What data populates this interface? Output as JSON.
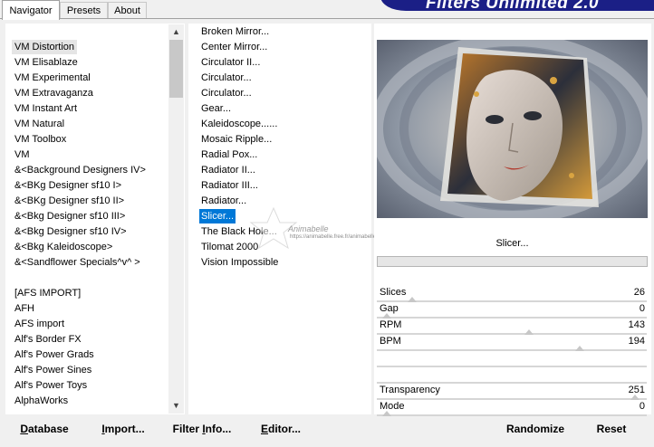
{
  "app": {
    "banner_title": "Filters Unlimited 2.0"
  },
  "tabs": [
    {
      "label": "Navigator",
      "active": true
    },
    {
      "label": "Presets",
      "active": false
    },
    {
      "label": "About",
      "active": false
    }
  ],
  "categories": [
    {
      "label": "VM Distortion",
      "selected": true
    },
    {
      "label": "VM Elisablaze"
    },
    {
      "label": "VM Experimental"
    },
    {
      "label": "VM Extravaganza"
    },
    {
      "label": "VM Instant Art"
    },
    {
      "label": "VM Natural"
    },
    {
      "label": "VM Toolbox"
    },
    {
      "label": "VM"
    },
    {
      "label": "&<Background Designers IV>"
    },
    {
      "label": "&<BKg Designer sf10 I>"
    },
    {
      "label": "&<BKg Designer sf10 II>"
    },
    {
      "label": "&<Bkg Designer sf10 III>"
    },
    {
      "label": "&<Bkg Designer sf10 IV>"
    },
    {
      "label": "&<Bkg Kaleidoscope>"
    },
    {
      "label": "&<Sandflower Specials^v^ >"
    },
    {
      "label": ""
    },
    {
      "label": "[AFS IMPORT]"
    },
    {
      "label": "AFH"
    },
    {
      "label": "AFS import"
    },
    {
      "label": "Alf's Border FX"
    },
    {
      "label": "Alf's Power Grads"
    },
    {
      "label": "Alf's Power Sines"
    },
    {
      "label": "Alf's Power Toys"
    },
    {
      "label": "AlphaWorks"
    }
  ],
  "scroll": {
    "up_icon": "▲",
    "down_icon": "▼"
  },
  "filters": [
    {
      "label": "Broken Mirror..."
    },
    {
      "label": "Center Mirror..."
    },
    {
      "label": "Circulator II..."
    },
    {
      "label": "Circulator..."
    },
    {
      "label": "Circulator..."
    },
    {
      "label": "Gear..."
    },
    {
      "label": "Kaleidoscope......"
    },
    {
      "label": "Mosaic Ripple..."
    },
    {
      "label": "Radial Pox..."
    },
    {
      "label": "Radiator II..."
    },
    {
      "label": "Radiator III..."
    },
    {
      "label": "Radiator..."
    },
    {
      "label": "Slicer...",
      "selected": true
    },
    {
      "label": "The Black Hole..."
    },
    {
      "label": "Tilomat 2000"
    },
    {
      "label": "Vision Impossible"
    }
  ],
  "preview": {
    "filter_name": "Slicer..."
  },
  "params": [
    {
      "label": "Slices",
      "value": "26",
      "level": 0.1
    },
    {
      "label": "Gap",
      "value": "0",
      "level": 0.0
    },
    {
      "label": "RPM",
      "value": "143",
      "level": 0.56
    },
    {
      "label": "BPM",
      "value": "194",
      "level": 0.76
    },
    {
      "label": "",
      "value": ""
    },
    {
      "label": "",
      "value": ""
    },
    {
      "label": "Transparency",
      "value": "251",
      "level": 0.98
    },
    {
      "label": "Mode",
      "value": "0",
      "level": 0.0
    }
  ],
  "buttons": {
    "database": {
      "u": "D",
      "rest": "atabase"
    },
    "import": {
      "u": "I",
      "rest": "mport..."
    },
    "filter_info": {
      "pre": "Filter ",
      "u": "I",
      "rest": "nfo..."
    },
    "editor": {
      "u": "E",
      "rest": "ditor..."
    },
    "randomize": "Randomize",
    "reset": "Reset"
  },
  "watermark": {
    "line1": "Animabelle",
    "line2": "https://animabelle.free.fr/animabelle/de"
  },
  "colors": {
    "selection": "#0078d7",
    "banner": "#1b1f86"
  }
}
